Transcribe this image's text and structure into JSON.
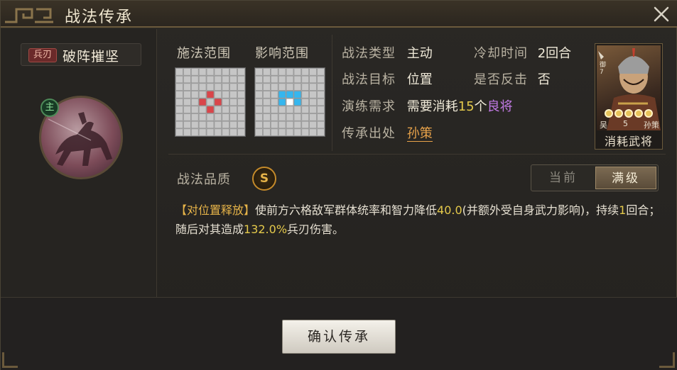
{
  "window": {
    "title": "战法传承"
  },
  "skill": {
    "troop_type": "兵刃",
    "name": "破阵摧坚",
    "main_badge": "主",
    "quality_label": "战法品质",
    "grade": "S"
  },
  "grids": {
    "cast_range_label": "施法范围",
    "effect_range_label": "影响范围",
    "cast_cells": [
      [
        3,
        4
      ],
      [
        4,
        3
      ],
      [
        4,
        5
      ],
      [
        5,
        4
      ]
    ],
    "effect_blue_cells": [
      [
        3,
        3
      ],
      [
        3,
        4
      ],
      [
        3,
        5
      ],
      [
        4,
        3
      ],
      [
        4,
        5
      ]
    ],
    "effect_white_cells": [
      [
        4,
        4
      ]
    ]
  },
  "info": {
    "type_label": "战法类型",
    "type_value": "主动",
    "cooldown_label": "冷却时间",
    "cooldown_value": "2回合",
    "target_label": "战法目标",
    "target_value": "位置",
    "counter_label": "是否反击",
    "counter_value": "否",
    "train_label": "演练需求",
    "train_prefix": "需要消耗",
    "train_count": "15",
    "train_unit": "个",
    "train_grade": "良将",
    "source_label": "传承出处",
    "source_value": "孙策"
  },
  "card": {
    "faction": "吴",
    "cost": "5",
    "name": "孙策",
    "role": "御",
    "level": "7",
    "stars": 5,
    "caption": "消耗武将"
  },
  "toggle": {
    "current_label": "当前",
    "max_label": "满级",
    "selected": "max"
  },
  "description": {
    "tag": "【对位置释放】",
    "part1": "使前方六格敌军群体统率和智力降低",
    "num1": "40.0",
    "part2": "(并额外受自身武力影响)，持续",
    "num2": "1",
    "part3": "回合；随后对其造成",
    "num3": "132.0%",
    "part4": "兵刃伤害。"
  },
  "actions": {
    "confirm_label": "确认传承"
  },
  "colors": {
    "cast_red": "#d9454a",
    "effect_blue": "#35b6ee",
    "accent_gold": "#e7b449"
  }
}
